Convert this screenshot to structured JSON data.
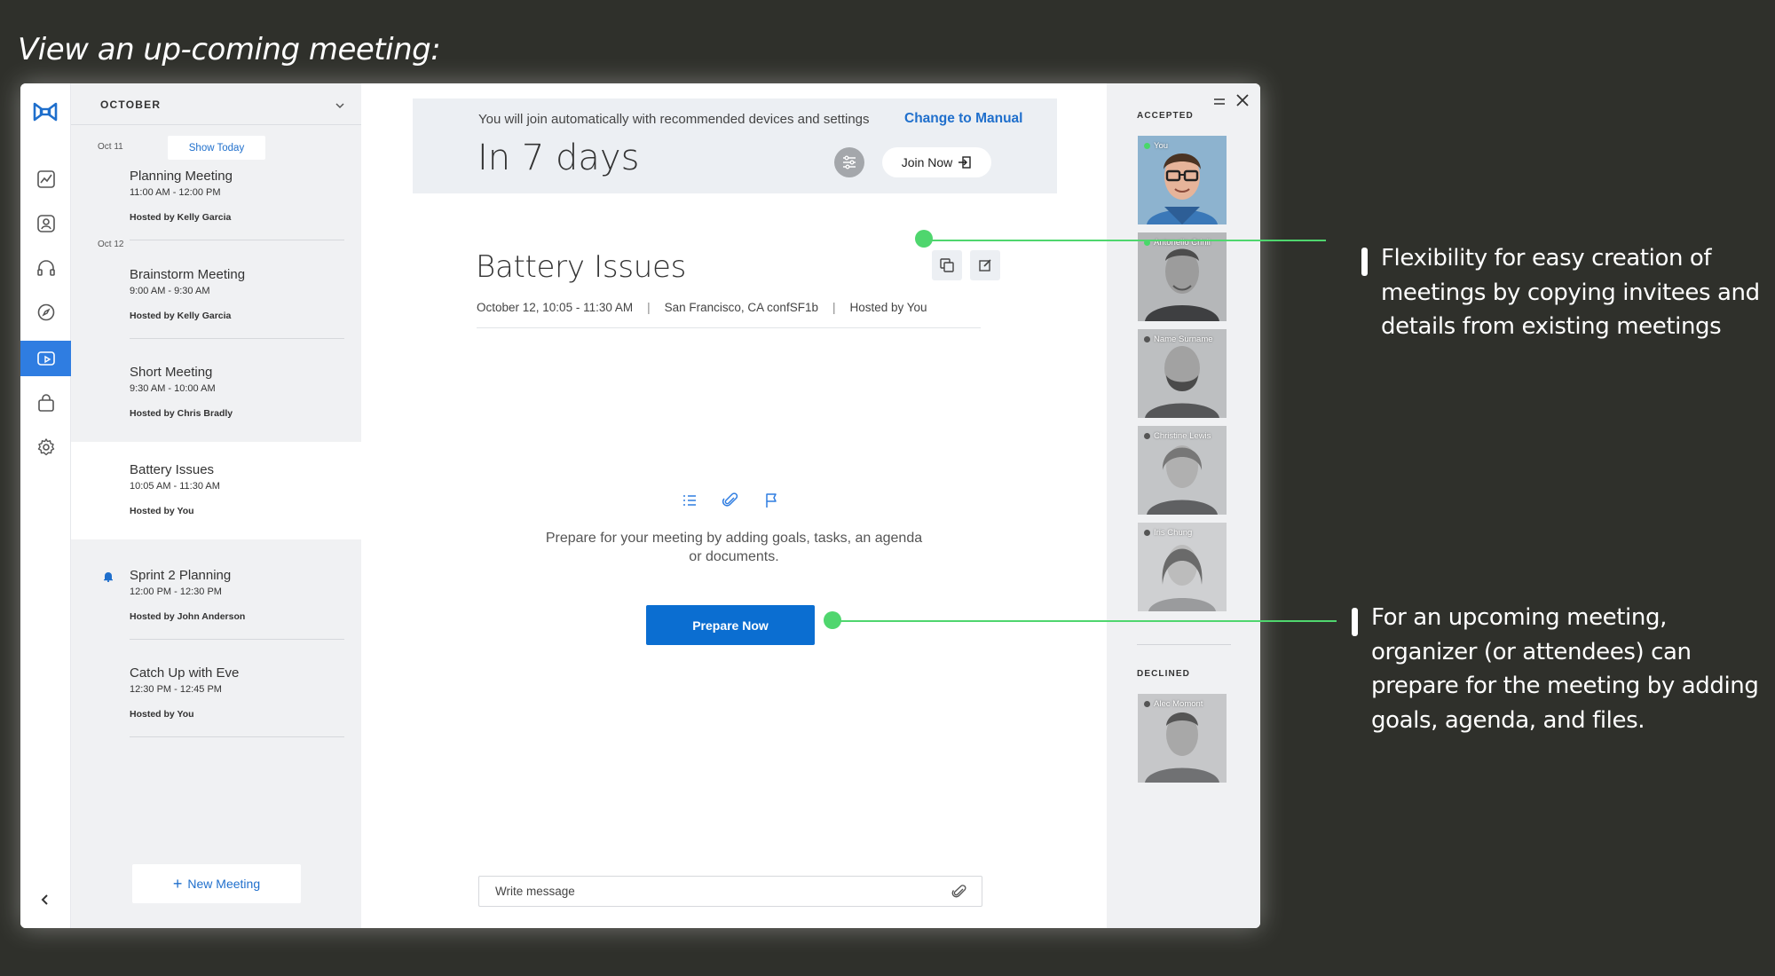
{
  "heading": "View an up-coming meeting:",
  "list": {
    "month": "OCTOBER",
    "show_today": "Show Today",
    "dates": [
      "Oct 11",
      "Oct 12"
    ],
    "meetings": [
      {
        "title": "Planning Meeting",
        "time": "11:00 AM - 12:00 PM",
        "host": "Hosted by Kelly Garcia"
      },
      {
        "title": "Brainstorm Meeting",
        "time": "9:00 AM - 9:30 AM",
        "host": "Hosted by Kelly Garcia"
      },
      {
        "title": "Short Meeting",
        "time": "9:30 AM - 10:00 AM",
        "host": "Hosted by Chris Bradly"
      },
      {
        "title": "Battery Issues",
        "time": "10:05 AM - 11:30 AM",
        "host": "Hosted by You"
      },
      {
        "title": "Sprint 2 Planning",
        "time": "12:00 PM - 12:30 PM",
        "host": "Hosted by John Anderson"
      },
      {
        "title": "Catch Up with Eve",
        "time": "12:30 PM - 12:45 PM",
        "host": "Hosted by You"
      }
    ],
    "new_meeting": "New Meeting"
  },
  "banner": {
    "text": "You will join automatically with recommended devices and settings",
    "link": "Change to Manual",
    "countdown": "In 7 days",
    "join": "Join Now"
  },
  "meeting": {
    "title": "Battery Issues",
    "date": "October 12, 10:05 - 11:30 AM",
    "location": "San Francisco, CA confSF1b",
    "host": "Hosted by You",
    "prepare_text": "Prepare for your meeting by adding goals, tasks, an agenda or documents.",
    "prepare_button": "Prepare Now",
    "message_placeholder": "Write message"
  },
  "attendees": {
    "accepted_label": "ACCEPTED",
    "declined_label": "DECLINED",
    "accepted": [
      {
        "name": "You",
        "online": true
      },
      {
        "name": "Antonello Crinil",
        "online": true
      },
      {
        "name": "Name Surname",
        "online": false
      },
      {
        "name": "Christine Lewis",
        "online": false
      },
      {
        "name": "Iris Chung",
        "online": false
      }
    ],
    "declined": [
      {
        "name": "Alec Momont",
        "online": false
      }
    ]
  },
  "annotations": {
    "copy": "Flexibility for easy creation of meetings by copying invitees and details from existing meetings",
    "prepare": "For an upcoming meeting, organizer (or attendees) can prepare for the meeting by adding goals, agenda, and files."
  },
  "colors": {
    "accent": "#0b6ed1",
    "annotation": "#4fd66e",
    "background": "#2f302b"
  }
}
